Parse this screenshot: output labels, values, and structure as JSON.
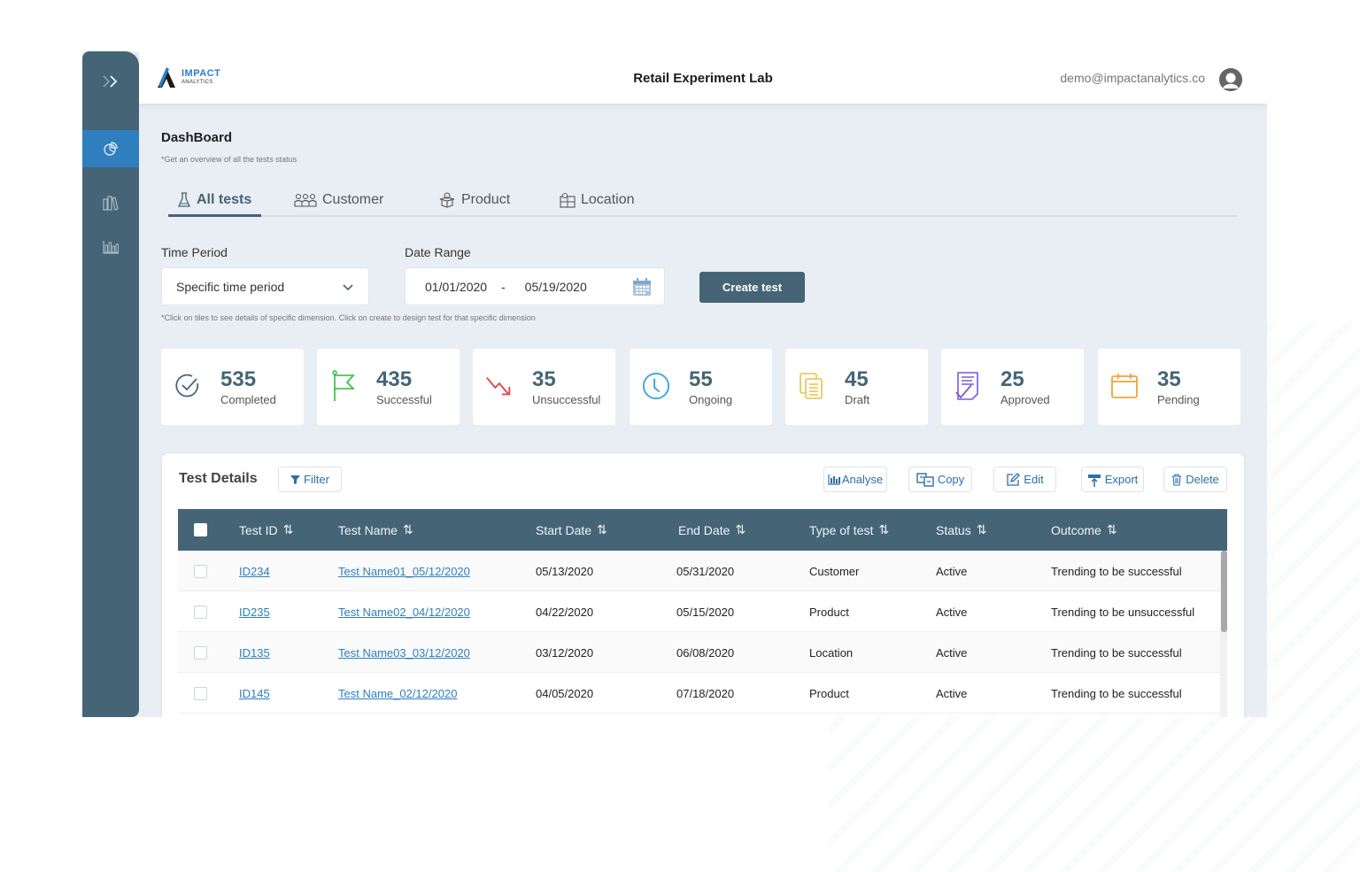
{
  "header": {
    "logo_line1": "IMPACT",
    "logo_line2": "ANALYTICS",
    "app_title": "Retail Experiment Lab",
    "user_email": "demo@impactanalytics.co"
  },
  "sidebar": {
    "items": [
      {
        "icon": "pie-chart-icon",
        "active": true
      },
      {
        "icon": "books-icon",
        "active": false
      },
      {
        "icon": "bar-chart-icon",
        "active": false
      }
    ]
  },
  "page": {
    "title": "DashBoard",
    "subtitle": "*Get an overview of all the tests status"
  },
  "tabs": [
    {
      "label": "All tests",
      "icon": "flask-icon",
      "active": true
    },
    {
      "label": "Customer",
      "icon": "people-icon",
      "active": false
    },
    {
      "label": "Product",
      "icon": "box-icon",
      "active": false
    },
    {
      "label": "Location",
      "icon": "map-pin-icon",
      "active": false
    }
  ],
  "filters": {
    "time_period_label": "Time Period",
    "time_period_value": "Specific time period",
    "date_range_label": "Date Range",
    "date_from": "01/01/2020",
    "date_separator": "-",
    "date_to": "05/19/2020",
    "create_button": "Create test",
    "hint": "*Click on tiles to see details of specific dimension.  Click on create to design test for that specific dimension"
  },
  "tiles": [
    {
      "value": "535",
      "label": "Completed",
      "icon": "check-circle-icon",
      "color": "#456577"
    },
    {
      "value": "435",
      "label": "Successful",
      "icon": "flag-icon",
      "color": "#2dbb3c"
    },
    {
      "value": "35",
      "label": "Unsuccessful",
      "icon": "trend-down-icon",
      "color": "#e04848"
    },
    {
      "value": "55",
      "label": "Ongoing",
      "icon": "clock-icon",
      "color": "#3aa3e8"
    },
    {
      "value": "45",
      "label": "Draft",
      "icon": "documents-icon",
      "color": "#e8c24a"
    },
    {
      "value": "25",
      "label": "Approved",
      "icon": "approved-doc-icon",
      "color": "#7a5bd6"
    },
    {
      "value": "35",
      "label": "Pending",
      "icon": "calendar-icon",
      "color": "#f0a43a"
    }
  ],
  "test_details": {
    "title": "Test Details",
    "filter_button": "Filter",
    "actions": {
      "analyse": "Analyse",
      "copy": "Copy",
      "edit": "Edit",
      "export": "Export",
      "delete": "Delete"
    },
    "columns": [
      "Test ID",
      "Test Name",
      "Start Date",
      "End Date",
      "Type of test",
      "Status",
      "Outcome"
    ],
    "rows": [
      {
        "id": "ID234",
        "name": "Test Name01_05/12/2020",
        "start": "05/13/2020",
        "end": "05/31/2020",
        "type": "Customer",
        "status": "Active",
        "outcome": "Trending to be successful"
      },
      {
        "id": "ID235",
        "name": "Test Name02_04/12/2020",
        "start": "04/22/2020",
        "end": "05/15/2020",
        "type": "Product",
        "status": "Active",
        "outcome": "Trending to be unsuccessful"
      },
      {
        "id": "ID135",
        "name": "Test Name03_03/12/2020",
        "start": "03/12/2020",
        "end": "06/08/2020",
        "type": "Location",
        "status": "Active",
        "outcome": "Trending to be successful"
      },
      {
        "id": "ID145",
        "name": "Test Name_02/12/2020",
        "start": "04/05/2020",
        "end": "07/18/2020",
        "type": "Product",
        "status": "Active",
        "outcome": "Trending to be successful"
      }
    ]
  },
  "colors": {
    "sidebar": "#456577",
    "sidebar_active": "#2f7fbf",
    "primary": "#456577",
    "link": "#2f7fbf",
    "background": "#e9edf4"
  }
}
